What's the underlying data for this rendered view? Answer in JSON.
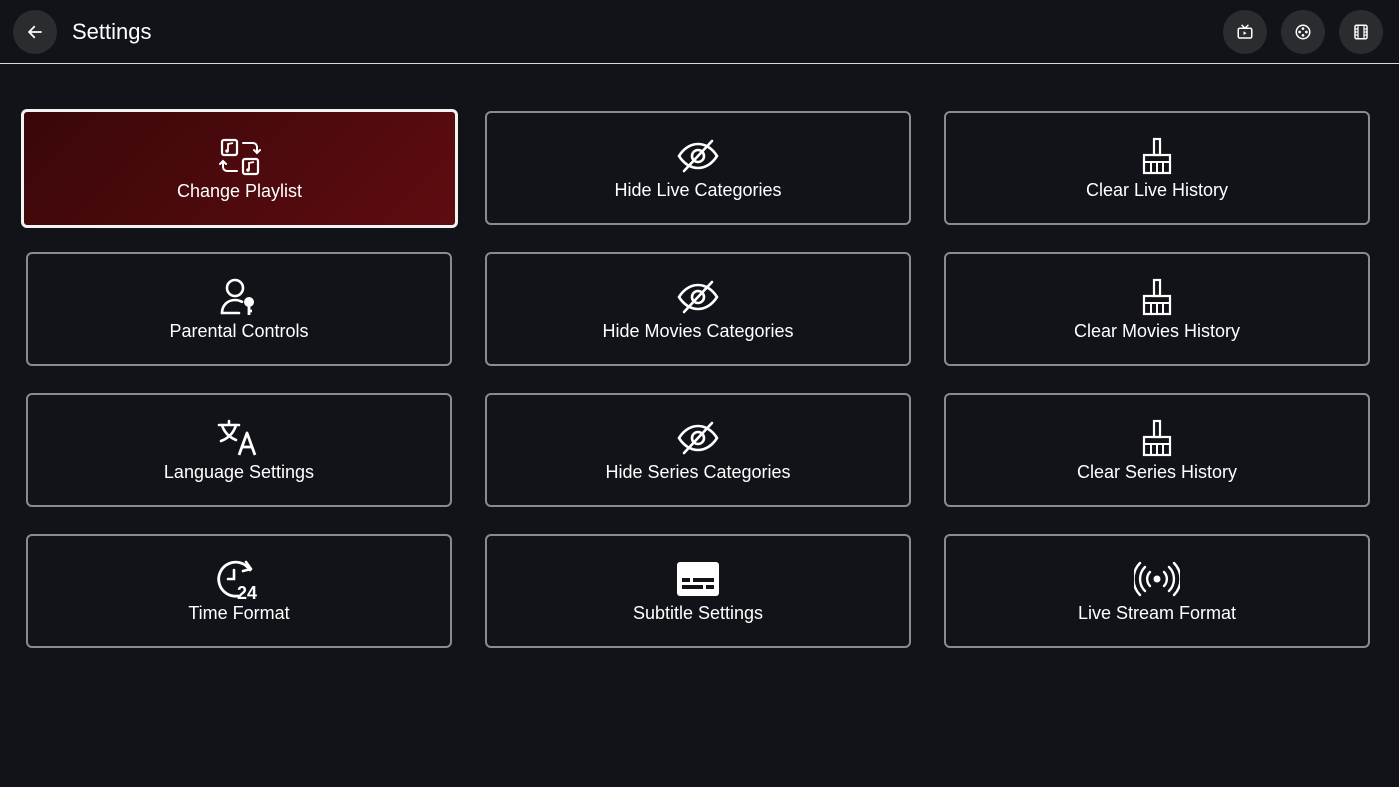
{
  "header": {
    "title": "Settings",
    "back_icon": "arrow-left-icon",
    "actions": [
      {
        "icon": "live-tv-icon"
      },
      {
        "icon": "movie-reel-icon"
      },
      {
        "icon": "film-strip-icon"
      }
    ]
  },
  "accent_color": "#5e0c10",
  "tiles": [
    {
      "label": "Change Playlist",
      "icon": "playlist-swap-icon",
      "selected": true
    },
    {
      "label": "Hide Live Categories",
      "icon": "eye-off-icon"
    },
    {
      "label": "Clear Live History",
      "icon": "broom-icon"
    },
    {
      "label": "Parental Controls",
      "icon": "user-key-icon"
    },
    {
      "label": "Hide Movies Categories",
      "icon": "eye-off-icon"
    },
    {
      "label": "Clear Movies History",
      "icon": "broom-icon"
    },
    {
      "label": "Language Settings",
      "icon": "translate-icon"
    },
    {
      "label": "Hide Series Categories",
      "icon": "eye-off-icon"
    },
    {
      "label": "Clear Series History",
      "icon": "broom-icon"
    },
    {
      "label": "Time Format",
      "icon": "clock-24-icon"
    },
    {
      "label": "Subtitle Settings",
      "icon": "subtitles-icon"
    },
    {
      "label": "Live Stream Format",
      "icon": "broadcast-icon"
    }
  ]
}
